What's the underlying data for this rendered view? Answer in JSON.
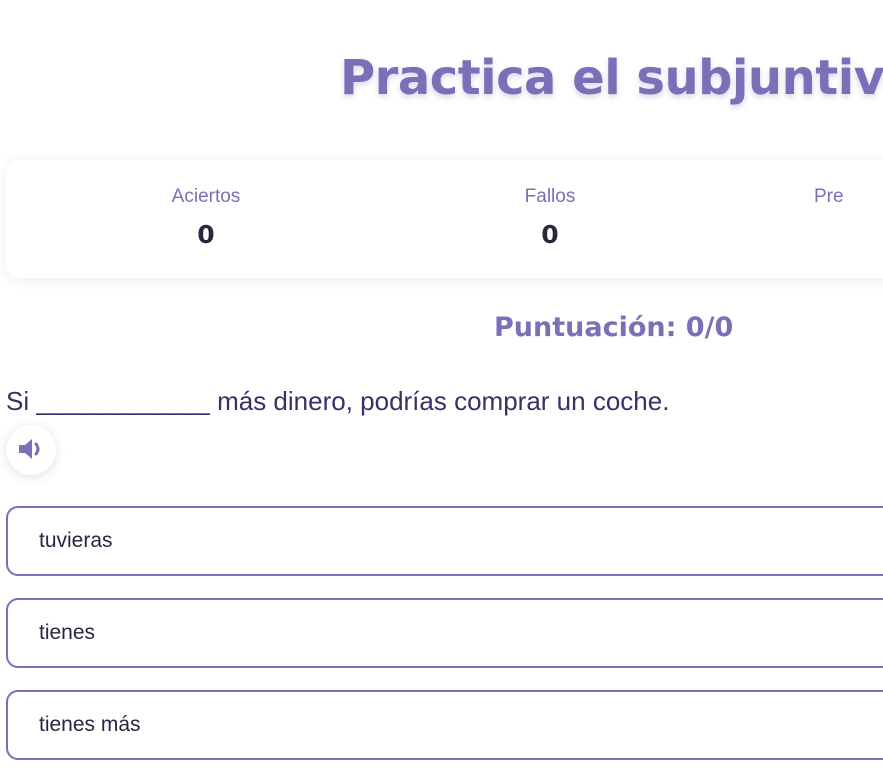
{
  "header": {
    "title": "Practica el subjuntivo"
  },
  "stats": {
    "correct_label": "Aciertos",
    "correct_value": "0",
    "wrong_label": "Fallos",
    "wrong_value": "0",
    "third_label_partial": "Pre"
  },
  "score": {
    "text": "Puntuación: 0/0"
  },
  "question": {
    "sentence": "Si ____________ más dinero, podrías comprar un coche.",
    "audio_icon": "speaker-icon"
  },
  "options": [
    {
      "label": "tuvieras"
    },
    {
      "label": "tienes"
    },
    {
      "label": "tienes más"
    }
  ],
  "colors": {
    "accent": "#7b6fb8",
    "text_dark": "#2b2640",
    "sentence_text": "#3a2f66"
  }
}
